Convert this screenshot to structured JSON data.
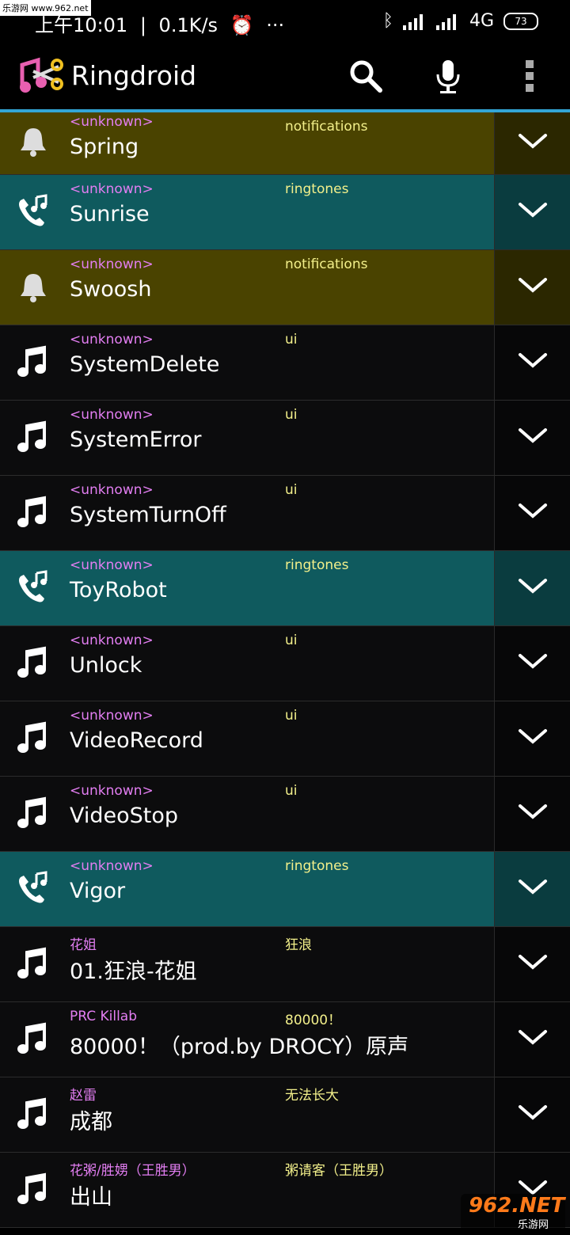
{
  "watermark": {
    "top": "乐游网 www.962.net",
    "bottom_big": "962.NET",
    "bottom_small": "乐游网"
  },
  "status_bar": {
    "time": "上午10:01",
    "speed": "0.1K/s",
    "network": "4G",
    "battery": "73"
  },
  "appbar": {
    "title": "Ringdroid",
    "actions": [
      "search-icon",
      "mic-icon",
      "overflow-menu-icon"
    ]
  },
  "colors": {
    "accent_line": "#33a6d6",
    "notification_row": "#4a4300",
    "ringtone_row": "#0f5a5e",
    "artist_text": "#e37ef2",
    "album_text": "#f3f08b"
  },
  "rows": [
    {
      "artist": "<unknown>",
      "album": "notifications",
      "title": "Spring",
      "kind": "notification"
    },
    {
      "artist": "<unknown>",
      "album": "ringtones",
      "title": "Sunrise",
      "kind": "ringtone"
    },
    {
      "artist": "<unknown>",
      "album": "notifications",
      "title": "Swoosh",
      "kind": "notification"
    },
    {
      "artist": "<unknown>",
      "album": "ui",
      "title": "SystemDelete",
      "kind": "music"
    },
    {
      "artist": "<unknown>",
      "album": "ui",
      "title": "SystemError",
      "kind": "music"
    },
    {
      "artist": "<unknown>",
      "album": "ui",
      "title": "SystemTurnOff",
      "kind": "music"
    },
    {
      "artist": "<unknown>",
      "album": "ringtones",
      "title": "ToyRobot",
      "kind": "ringtone"
    },
    {
      "artist": "<unknown>",
      "album": "ui",
      "title": "Unlock",
      "kind": "music"
    },
    {
      "artist": "<unknown>",
      "album": "ui",
      "title": "VideoRecord",
      "kind": "music"
    },
    {
      "artist": "<unknown>",
      "album": "ui",
      "title": "VideoStop",
      "kind": "music"
    },
    {
      "artist": "<unknown>",
      "album": "ringtones",
      "title": "Vigor",
      "kind": "ringtone"
    },
    {
      "artist": "花姐",
      "album": "狂浪",
      "title": "01.狂浪-花姐",
      "kind": "music"
    },
    {
      "artist": "PRC Killab",
      "album": "80000！",
      "title": "80000！（prod.by DROCY）原声",
      "kind": "music"
    },
    {
      "artist": "赵雷",
      "album": "无法长大",
      "title": "成都",
      "kind": "music"
    },
    {
      "artist": "花粥/胜娚（王胜男）",
      "album": "粥请客（王胜男）",
      "title": "出山",
      "kind": "music"
    }
  ]
}
